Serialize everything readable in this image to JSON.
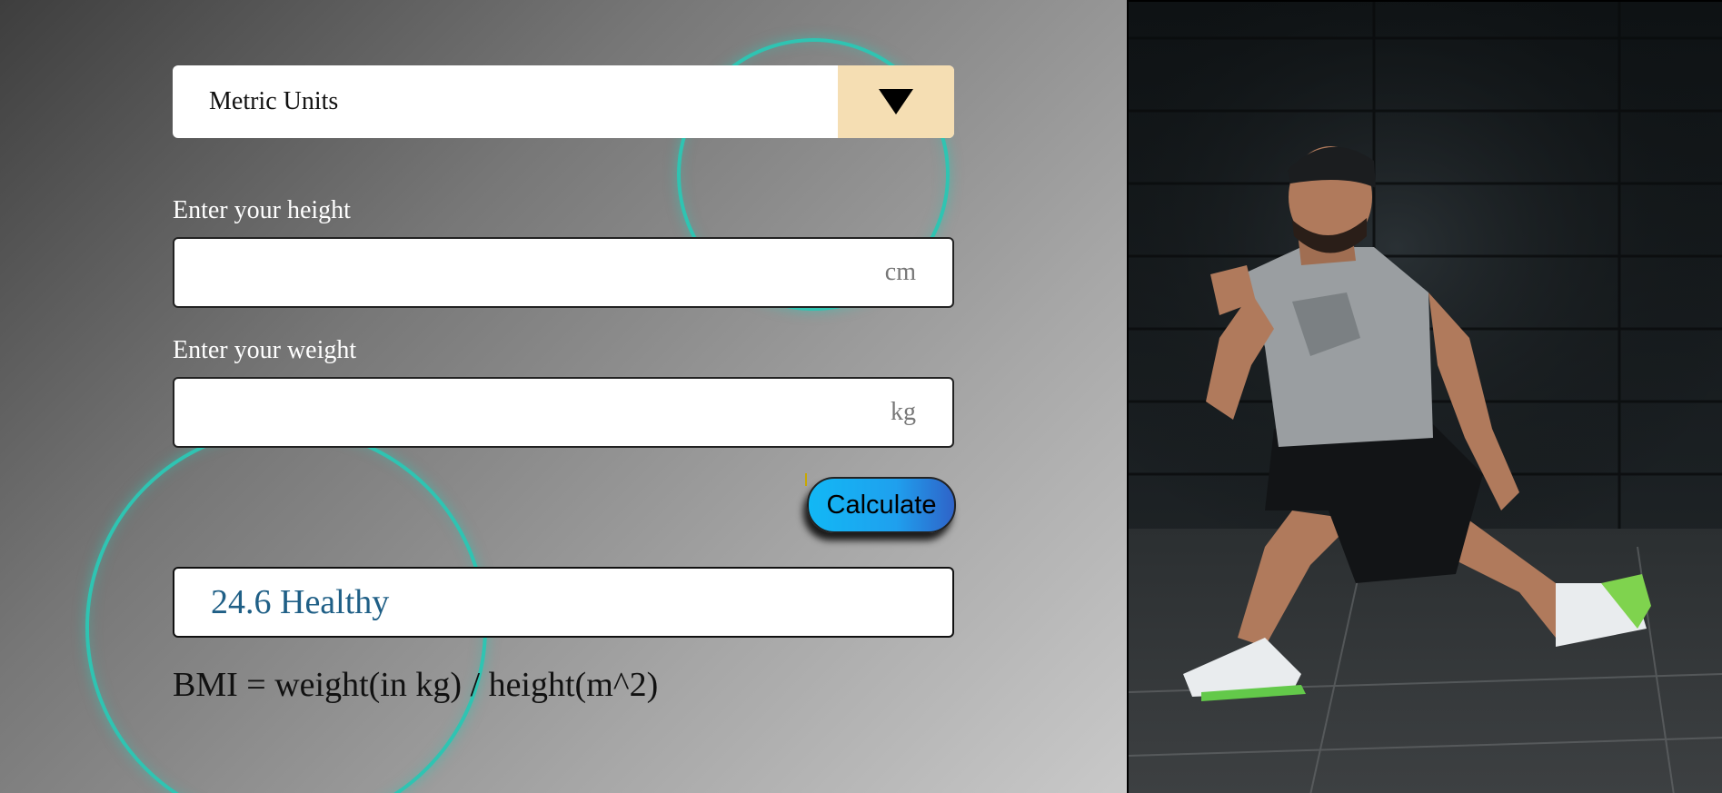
{
  "units_select": {
    "selected": "Metric Units",
    "arrow_icon": "triangle-down-icon"
  },
  "height": {
    "label": "Enter your height",
    "value": "",
    "unit": "cm"
  },
  "weight": {
    "label": "Enter your weight",
    "value": "",
    "unit": "kg"
  },
  "calculate_button": {
    "label": "Calculate"
  },
  "result": {
    "text": "24.6 Healthy"
  },
  "formula": "BMI = weight(in kg) / height(m^2)",
  "colors": {
    "ring": "#2fc4b2",
    "dropdown_arrow_bg": "#f5deb3",
    "result_text": "#1f5f86",
    "button_gradient_start": "#12b8f5",
    "button_gradient_end": "#2f63c8"
  }
}
